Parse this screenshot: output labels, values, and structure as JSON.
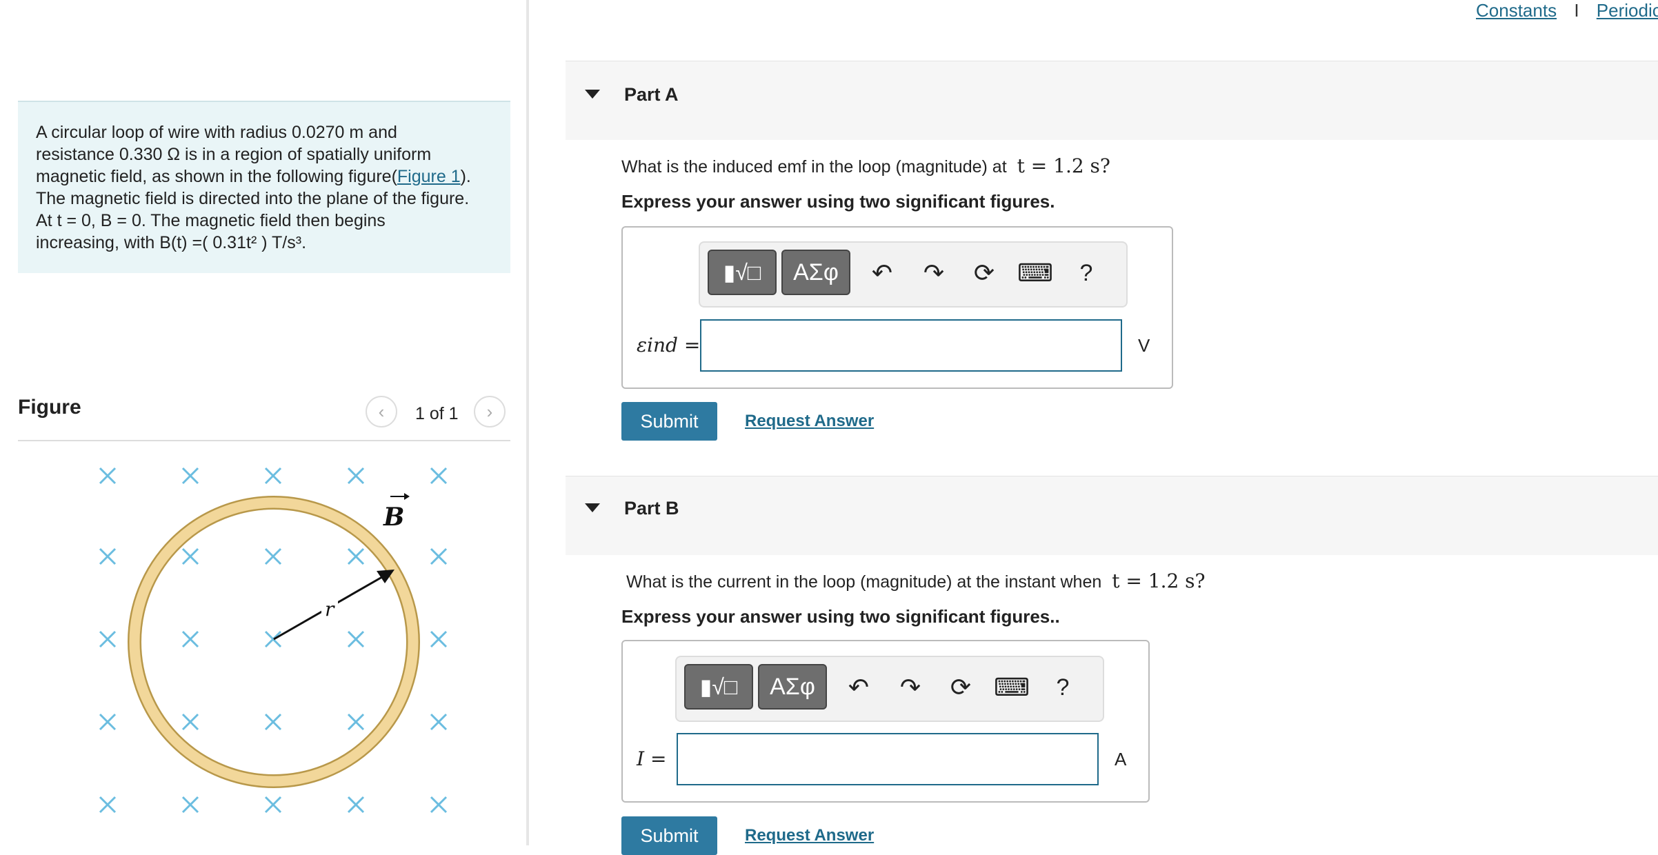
{
  "header": {
    "constants_link": "Constants",
    "separator": "I",
    "periodic_link": "Periodic"
  },
  "problem": {
    "line1": "A circular loop of wire with radius 0.0270 m and",
    "line2": "resistance 0.330 Ω is in a region of spatially uniform",
    "line3_prefix": "magnetic field, as shown in the following figure(",
    "figure_link": "Figure 1",
    "line3_suffix": ").",
    "line4": "The magnetic field is directed into the plane of the figure.",
    "line5": "At t = 0, B = 0. The magnetic field then begins",
    "line6": "increasing, with B(t) =( 0.31t² ) T/s³."
  },
  "figure": {
    "title": "Figure",
    "counter": "1 of 1",
    "prev_icon": "chevron-left-icon",
    "next_icon": "chevron-right-icon",
    "field_label": "B",
    "radius_label": "r",
    "colors": {
      "cross": "#6bbde0",
      "ring": "#f2d79a",
      "ring_edge": "#b8984a"
    }
  },
  "part_a": {
    "title": "Part A",
    "question_prefix": "What is the induced emf in the loop (magnitude) at",
    "question_math": "t = 1.2 s?",
    "express": "Express your answer using two significant figures.",
    "toolbar": {
      "templates_icon": "math-templates-icon",
      "greek_label": "ΑΣφ",
      "undo_icon": "undo-icon",
      "redo_icon": "redo-icon",
      "reset_icon": "reset-icon",
      "keyboard_icon": "keyboard-icon",
      "help_label": "?"
    },
    "variable": "εind =",
    "input_value": "",
    "unit": "V",
    "submit_label": "Submit",
    "request_label": "Request Answer"
  },
  "part_b": {
    "title": "Part B",
    "question_prefix": "What is the current in the loop (magnitude) at the instant when",
    "question_math": "t = 1.2 s?",
    "express": "Express your answer using two significant figures..",
    "toolbar": {
      "templates_icon": "math-templates-icon",
      "greek_label": "ΑΣφ",
      "undo_icon": "undo-icon",
      "redo_icon": "redo-icon",
      "reset_icon": "reset-icon",
      "keyboard_icon": "keyboard-icon",
      "help_label": "?"
    },
    "variable": "I =",
    "input_value": "",
    "unit": "A",
    "submit_label": "Submit",
    "request_label": "Request Answer"
  }
}
